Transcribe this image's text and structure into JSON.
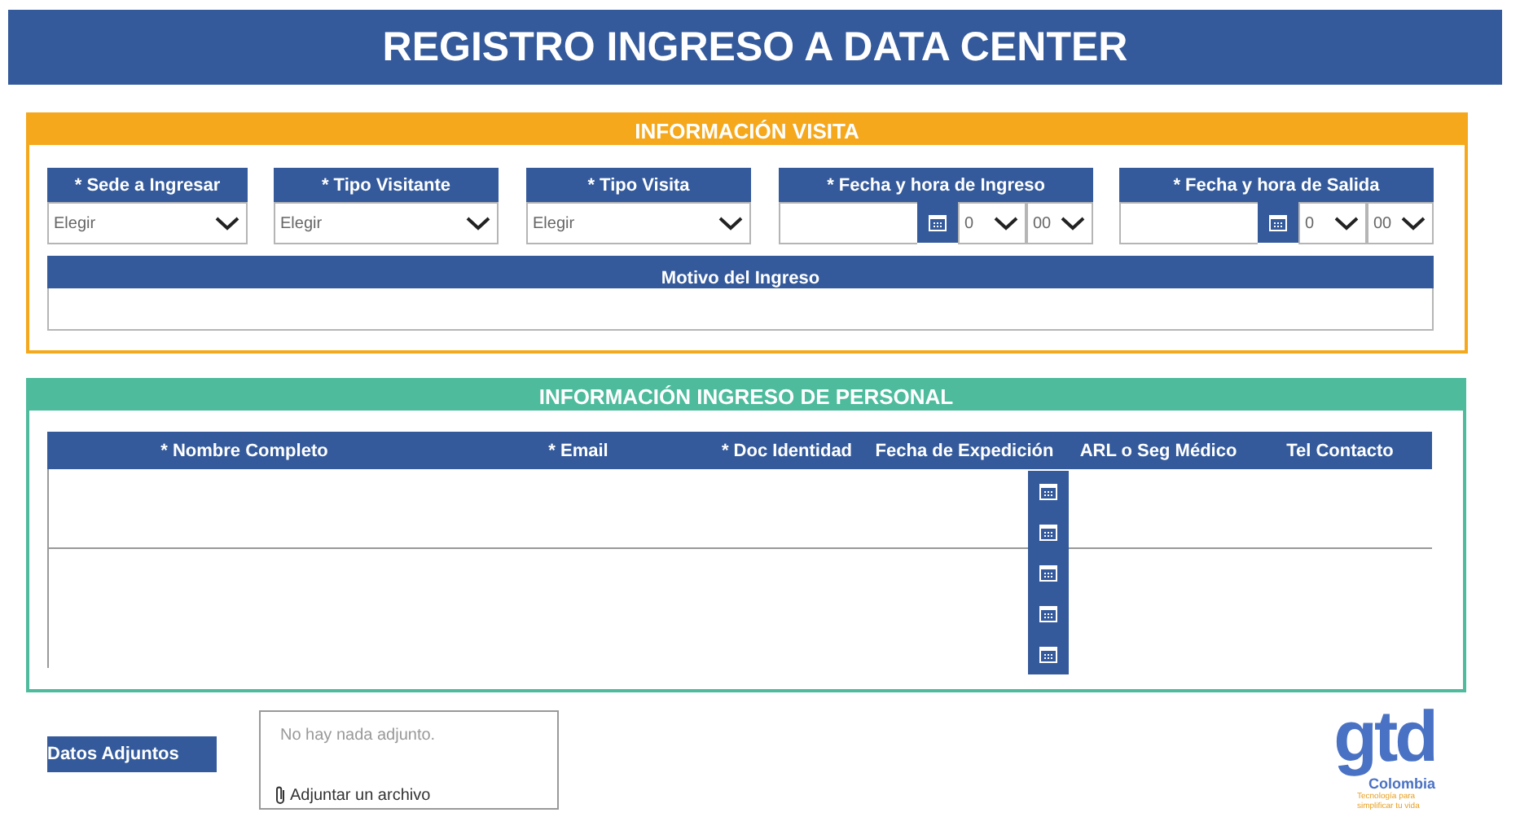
{
  "title": "REGISTRO INGRESO A DATA CENTER",
  "visit_section": {
    "title": "INFORMACIÓN VISITA",
    "fields": [
      {
        "kind": "select",
        "label": "* Sede a Ingresar",
        "value": "Elegir"
      },
      {
        "kind": "select",
        "label": "* Tipo Visitante",
        "value": "Elegir"
      },
      {
        "kind": "select",
        "label": "* Tipo Visita",
        "value": "Elegir"
      },
      {
        "kind": "datetime",
        "label": "* Fecha y hora de Ingreso",
        "hour": "0",
        "minute": "00"
      },
      {
        "kind": "datetime",
        "label": "* Fecha y hora de Salida",
        "hour": "0",
        "minute": "00"
      }
    ],
    "reason": {
      "label": "Motivo del Ingreso"
    }
  },
  "personnel_section": {
    "title": "INFORMACIÓN INGRESO DE PERSONAL",
    "columns": [
      "* Nombre Completo",
      "* Email",
      "* Doc Identidad",
      "Fecha de Expedición",
      "ARL o Seg Médico",
      "Tel Contacto"
    ]
  },
  "attachments": {
    "label": "Datos Adjuntos",
    "empty_text": "No hay nada adjunto.",
    "add_link": "Adjuntar un archivo"
  },
  "logo": {
    "wordmark": "gtd",
    "country": "Colombia",
    "tagline": "Tecnología para simplificar tu vida"
  }
}
